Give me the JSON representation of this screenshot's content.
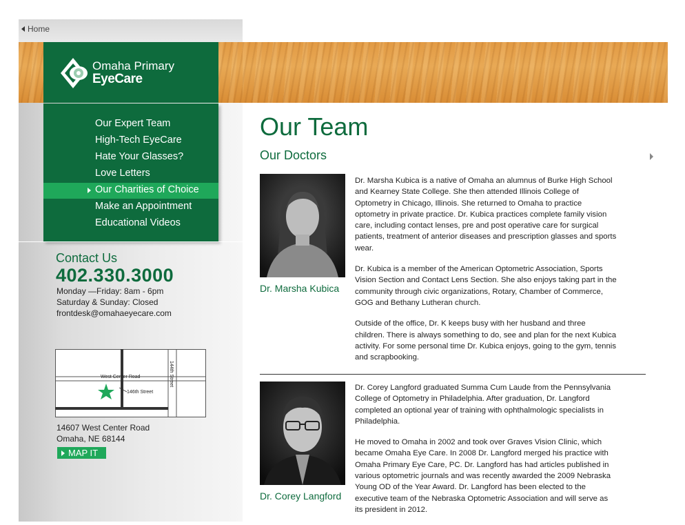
{
  "topbar": {
    "home_label": "Home"
  },
  "logo": {
    "line1": "Omaha Primary",
    "line2": "EyeCare"
  },
  "nav": {
    "items": [
      {
        "label": "Our Expert Team"
      },
      {
        "label": "High-Tech EyeCare"
      },
      {
        "label": "Hate Your Glasses?"
      },
      {
        "label": "Love Letters"
      },
      {
        "label": "Our Charities of Choice"
      },
      {
        "label": "Make an Appointment"
      },
      {
        "label": "Educational Videos"
      }
    ],
    "active_index": 4
  },
  "contact": {
    "title": "Contact Us",
    "phone": "402.330.3000",
    "hours_weekday": "Monday —Friday: 8am - 6pm",
    "hours_weekend": "Saturday & Sunday: Closed",
    "email": "frontdesk@omahaeyecare.com"
  },
  "map": {
    "road_main": "West Center Road",
    "road_cross1": "144th Street",
    "road_cross2": "146th Street"
  },
  "address": {
    "line1": "14607 West Center Road",
    "line2": "Omaha, NE 68144",
    "map_button": "MAP IT"
  },
  "main": {
    "title": "Our Team",
    "section": "Our Doctors",
    "doctors": [
      {
        "name": "Dr. Marsha Kubica",
        "bio": [
          "Dr. Marsha Kubica is a native of Omaha an alumnus of Burke High School and Kearney State College. She then attended Illinois College of Optometry in Chicago, Illinois. She returned to Omaha to practice optometry in private practice. Dr. Kubica practices complete family vision care, including contact lenses, pre and post operative care for surgical patients, treatment of anterior diseases and prescription glasses and sports wear.",
          "Dr. Kubica is a member of the American Optometric Association, Sports Vision Section and Contact Lens Section. She also enjoys taking part in the community through civic organizations, Rotary, Chamber of Commerce, GOG and Bethany Lutheran church.",
          "Outside of the office, Dr. K keeps busy with her husband and three children. There is always something to do, see and plan for the next Kubica activity. For some personal time Dr. Kubica enjoys, going to the gym, tennis and scrapbooking."
        ]
      },
      {
        "name": "Dr. Corey Langford",
        "bio": [
          "Dr. Corey Langford graduated Summa Cum Laude from the Pennsylvania College of Optometry in Philadelphia. After graduation, Dr. Langford completed an optional year of training with ophthalmologic specialists in Philadelphia.",
          "He moved to Omaha in 2002 and took over Graves Vision Clinic, which became Omaha Eye Care. In 2008 Dr. Langford merged his practice with Omaha Primary Eye Care, PC. Dr. Langford has had articles published in various optometric journals and was recently awarded the 2009 Nebraska Young OD of the Year Award. Dr. Langford has been elected to the executive team of the Nebraska Optometric Association and will serve as its president in 2012."
        ]
      }
    ]
  },
  "colors": {
    "brand_green": "#0e6b3d",
    "accent_green": "#1fa85a",
    "wood": "#e29a44"
  }
}
